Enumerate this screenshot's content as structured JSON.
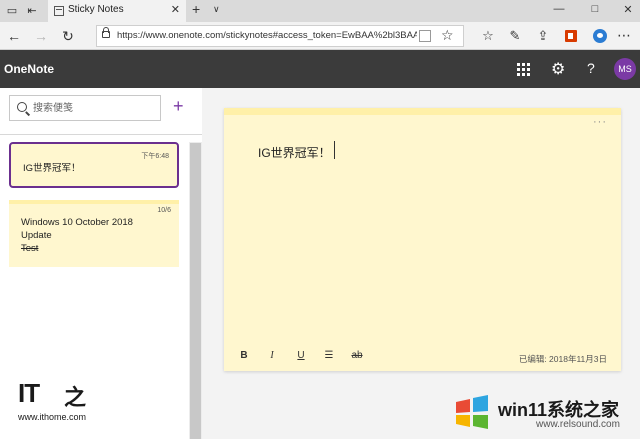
{
  "browser": {
    "tab_title": "Sticky Notes",
    "address_url": "https://www.onenote.com/stickynotes#access_token=EwBAA%2bl3BAAUv"
  },
  "app": {
    "brand": "OneNote",
    "avatar_initials": "MS",
    "help_label": "?"
  },
  "sidebar": {
    "search_placeholder": "搜索便笺",
    "add_label": "+",
    "notes": [
      {
        "timestamp": "下午6:48",
        "lines": [
          "IG世界冠军！"
        ],
        "selected": true
      },
      {
        "timestamp": "10/6",
        "lines": [
          "Windows 10 October 2018",
          "Update",
          "Test"
        ],
        "selected": false
      }
    ]
  },
  "editor": {
    "content": "IG世界冠军！",
    "more_label": "···",
    "toolbar": {
      "bold": "B",
      "italic": "I",
      "underline": "U",
      "bullets": "☰",
      "strike": "ab"
    },
    "last_edited": "已编辑: 2018年11月3日"
  },
  "watermarks": {
    "left_brand": "IT",
    "left_brand_char": "之",
    "left_site": "www.ithome.com",
    "right_brand": "win11系统之家",
    "right_site": "www.relsound.com"
  },
  "colors": {
    "accent_purple": "#7b3aa5",
    "note_yellow": "#fff7cf",
    "note_strip": "#fff0a8",
    "header_dark": "#3b3b3b"
  }
}
